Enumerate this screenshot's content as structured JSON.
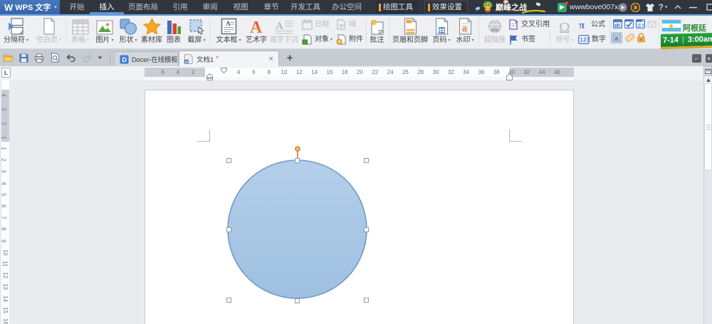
{
  "titlebar": {
    "logo_mark": "W",
    "logo_text": "WPS 文字",
    "logo_caret": "▾",
    "menu_tabs": [
      {
        "label": "开始",
        "active": false
      },
      {
        "label": "插入",
        "active": true
      },
      {
        "label": "页面布局",
        "active": false
      },
      {
        "label": "引用",
        "active": false
      },
      {
        "label": "审阅",
        "active": false
      },
      {
        "label": "视图",
        "active": false
      },
      {
        "label": "章节",
        "active": false
      },
      {
        "label": "开发工具",
        "active": false
      },
      {
        "label": "办公空间",
        "active": false
      }
    ],
    "context_tabs": {
      "drawing_tools": "绘图工具",
      "effect_settings": "效果设置"
    },
    "promo_text": "巅峰之战",
    "username": "wwwbove007x",
    "username_caret": "▾",
    "help_label": "?",
    "help_caret": "▾",
    "window_controls": {
      "collapse_ribbon": "⌃",
      "minimize": "—",
      "maximize": "❐"
    }
  },
  "ribbon": {
    "separator": {
      "label": "分隔符",
      "arrow": "▾"
    },
    "blank_page": {
      "label": "空白页",
      "arrow": "▾"
    },
    "table": {
      "label": "表格",
      "arrow": "▾"
    },
    "picture": {
      "label": "图片",
      "arrow": "▾"
    },
    "shapes": {
      "label": "形状",
      "arrow": "▾"
    },
    "asset_library": {
      "label": "素材库"
    },
    "chart": {
      "label": "图表"
    },
    "screenshot": {
      "label": "截屏",
      "arrow": "▾"
    },
    "text_box": {
      "label": "文本框",
      "arrow": "▾"
    },
    "word_art": {
      "label": "艺术字"
    },
    "drop_cap": {
      "label": "首字下沉"
    },
    "date": {
      "label": "日期"
    },
    "object": {
      "label": "对象",
      "arrow": "▾"
    },
    "field": {
      "label": "域"
    },
    "attachment": {
      "label": "附件"
    },
    "comment": {
      "label": "批注"
    },
    "header_footer": {
      "label": "页眉和页脚"
    },
    "page_number": {
      "label": "页码",
      "arrow": "▾"
    },
    "watermark": {
      "label": "水印",
      "arrow": "▾"
    },
    "hyperlink": {
      "label": "超链接"
    },
    "cross_reference": {
      "label": "交叉引用"
    },
    "bookmark": {
      "label": "书签"
    },
    "symbol": {
      "label": "符号",
      "arrow": "▾"
    },
    "formula": {
      "label": "公式"
    },
    "number": {
      "label": "数字"
    },
    "promo_team": "阿根廷",
    "promo_date": "7-14",
    "promo_divider": "|",
    "promo_time": "3:00am"
  },
  "tabbar": {
    "doc_tabs": [
      {
        "label": "Docer-在线模板",
        "close": "×",
        "active": false
      },
      {
        "label": "文档1",
        "dirty": "*",
        "close": "×",
        "active": true
      }
    ],
    "new_tab": "+"
  },
  "ruler": {
    "tab_selector": "L",
    "h_origin": 292.5,
    "h_unit": 10.65,
    "h_numbers_white": [
      4,
      6,
      8,
      10,
      12,
      14,
      16,
      18,
      20,
      22,
      24,
      26,
      28,
      30,
      32,
      34,
      36,
      38
    ],
    "h_numbers_left_margin": [
      6,
      4,
      2
    ],
    "h_numbers_right_margin": [
      40,
      42,
      44,
      46
    ],
    "v_numbers_margin": [
      4,
      3,
      2,
      1
    ],
    "v_numbers_main": [
      1,
      2,
      3,
      4,
      5,
      6,
      7,
      8,
      9,
      10,
      11,
      12,
      13,
      14,
      15,
      16
    ],
    "v_main_origin": 95,
    "v_main_unit": 16.2
  },
  "document": {
    "shape": {
      "type": "ellipse",
      "fill_top": "#b3cee9",
      "fill_bottom": "#9ec0e1",
      "stroke": "#6e9ac7"
    }
  },
  "colors": {
    "titlebar": "#31353e",
    "accent_blue": "#5d93d9",
    "context_marker": "#f2a31d",
    "ribbon_bg": "#eef0f3",
    "tabbar_bg": "#c7ccd3",
    "canvas": "#e9ebef",
    "banner_green": "#1f9434"
  }
}
